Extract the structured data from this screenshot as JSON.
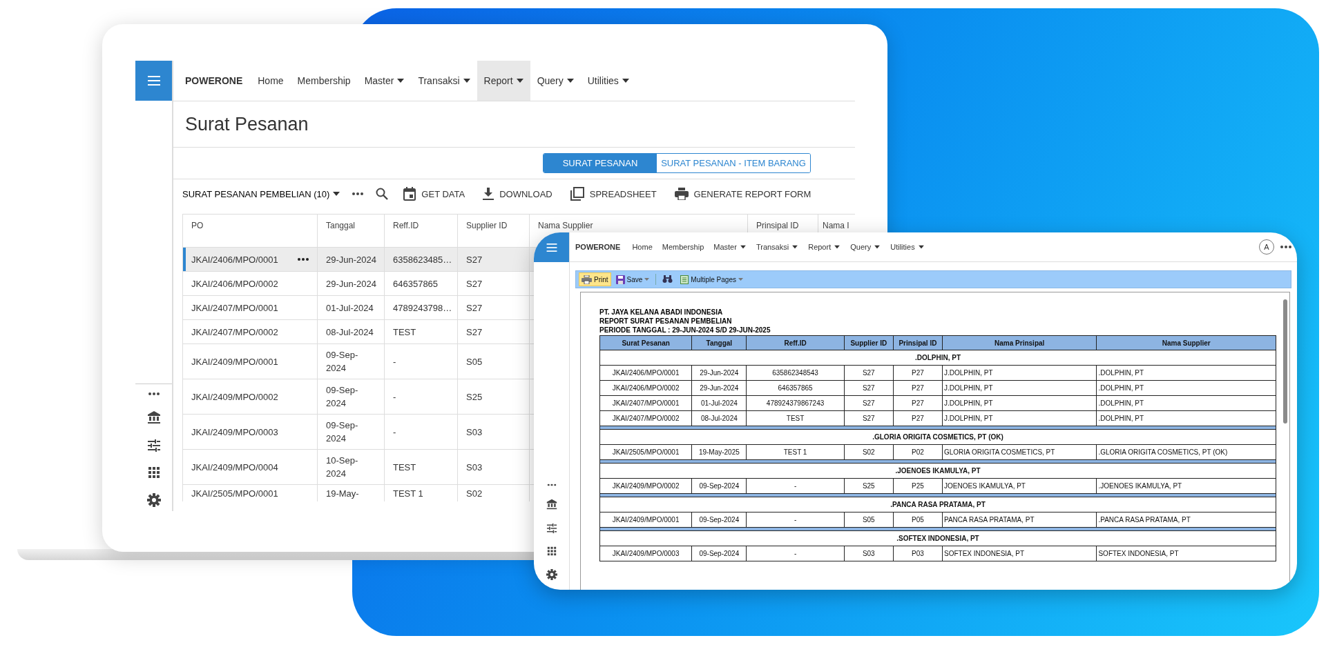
{
  "laptop": {
    "navbar": {
      "brand": "POWERONE",
      "items": [
        {
          "label": "Home",
          "dropdown": false,
          "selected": false
        },
        {
          "label": "Membership",
          "dropdown": false,
          "selected": false
        },
        {
          "label": "Master",
          "dropdown": true,
          "selected": false
        },
        {
          "label": "Transaksi",
          "dropdown": true,
          "selected": false
        },
        {
          "label": "Report",
          "dropdown": true,
          "selected": true
        },
        {
          "label": "Query",
          "dropdown": true,
          "selected": false
        },
        {
          "label": "Utilities",
          "dropdown": true,
          "selected": false
        }
      ]
    },
    "page_title": "Surat Pesanan",
    "view_tabs": [
      {
        "label": "SURAT PESANAN",
        "selected": true
      },
      {
        "label": "SURAT PESANAN - ITEM BARANG",
        "selected": false
      }
    ],
    "toolbar": {
      "report_select": "SURAT PESANAN PEMBELIAN (10)",
      "actions": [
        {
          "kind": "more"
        },
        {
          "kind": "search"
        },
        {
          "kind": "get-data",
          "label": "GET DATA"
        },
        {
          "kind": "download",
          "label": "DOWNLOAD"
        },
        {
          "kind": "spreadsheet",
          "label": "SPREADSHEET"
        },
        {
          "kind": "print",
          "label": "GENERATE REPORT FORM"
        }
      ]
    },
    "table": {
      "columns": [
        "PO",
        "Tanggal",
        "Reff.ID",
        "Supplier ID",
        "Nama Supplier",
        "Prinsipal ID",
        "Nama I"
      ],
      "rows": [
        {
          "selected": true,
          "cells": [
            "JKAI/2406/MPO/0001",
            "29-Jun-2024",
            "6358623485…",
            "S27"
          ]
        },
        {
          "selected": false,
          "cells": [
            "JKAI/2406/MPO/0002",
            "29-Jun-2024",
            "646357865",
            "S27"
          ]
        },
        {
          "selected": false,
          "cells": [
            "JKAI/2407/MPO/0001",
            "01-Jul-2024",
            "4789243798…",
            "S27"
          ]
        },
        {
          "selected": false,
          "cells": [
            "JKAI/2407/MPO/0002",
            "08-Jul-2024",
            "TEST",
            "S27"
          ]
        },
        {
          "selected": false,
          "cells": [
            "JKAI/2409/MPO/0001",
            "09-Sep-2024",
            "-",
            "S05"
          ]
        },
        {
          "selected": false,
          "cells": [
            "JKAI/2409/MPO/0002",
            "09-Sep-2024",
            "-",
            "S25"
          ]
        },
        {
          "selected": false,
          "cells": [
            "JKAI/2409/MPO/0003",
            "09-Sep-2024",
            "-",
            "S03"
          ]
        },
        {
          "selected": false,
          "cells": [
            "JKAI/2409/MPO/0004",
            "10-Sep-2024",
            "TEST",
            "S03"
          ]
        },
        {
          "selected": false,
          "cells": [
            "JKAI/2505/MPO/0001",
            "19-May-",
            "TEST 1",
            "S02"
          ]
        }
      ]
    }
  },
  "tablet": {
    "navbar": {
      "brand": "POWERONE",
      "avatar": "A",
      "items": [
        {
          "label": "Home",
          "dropdown": false,
          "selected": false
        },
        {
          "label": "Membership",
          "dropdown": false,
          "selected": false
        },
        {
          "label": "Master",
          "dropdown": true,
          "selected": false
        },
        {
          "label": "Transaksi",
          "dropdown": true,
          "selected": false
        },
        {
          "label": "Report",
          "dropdown": true,
          "selected": false
        },
        {
          "label": "Query",
          "dropdown": true,
          "selected": false
        },
        {
          "label": "Utilities",
          "dropdown": true,
          "selected": false
        }
      ]
    },
    "report_toolbar": [
      {
        "kind": "print",
        "label": "Print",
        "selected": true,
        "dropdown": false
      },
      {
        "kind": "save",
        "label": "Save",
        "selected": false,
        "dropdown": true
      },
      {
        "kind": "find",
        "selected": false,
        "dropdown": false
      },
      {
        "kind": "pages",
        "label": "Multiple Pages",
        "selected": false,
        "dropdown": true
      }
    ],
    "report": {
      "header_lines": [
        "PT. JAYA KELANA ABADI INDONESIA",
        "REPORT SURAT PESANAN PEMBELIAN",
        "PERIODE TANGGAL : 29-JUN-2024 S/D 29-JUN-2025"
      ],
      "columns": [
        "Surat Pesanan",
        "Tanggal",
        "Reff.ID",
        "Supplier ID",
        "Prinsipal ID",
        "Nama Prinsipal",
        "Nama Supplier"
      ],
      "groups": [
        {
          "name": ".DOLPHIN, PT",
          "rows": [
            [
              "JKAI/2406/MPO/0001",
              "29-Jun-2024",
              "635862348543",
              "S27",
              "P27",
              "J.DOLPHIN, PT",
              ".DOLPHIN, PT"
            ],
            [
              "JKAI/2406/MPO/0002",
              "29-Jun-2024",
              "646357865",
              "S27",
              "P27",
              "J.DOLPHIN, PT",
              ".DOLPHIN, PT"
            ],
            [
              "JKAI/2407/MPO/0001",
              "01-Jul-2024",
              "478924379867243",
              "S27",
              "P27",
              "J.DOLPHIN, PT",
              ".DOLPHIN, PT"
            ],
            [
              "JKAI/2407/MPO/0002",
              "08-Jul-2024",
              "TEST",
              "S27",
              "P27",
              "J.DOLPHIN, PT",
              ".DOLPHIN, PT"
            ]
          ]
        },
        {
          "name": ".GLORIA ORIGITA COSMETICS, PT (OK)",
          "rows": [
            [
              "JKAI/2505/MPO/0001",
              "19-May-2025",
              "TEST 1",
              "S02",
              "P02",
              "GLORIA ORIGITA COSMETICS, PT",
              ".GLORIA ORIGITA COSMETICS, PT (OK)"
            ]
          ]
        },
        {
          "name": ".JOENOES IKAMULYA, PT",
          "rows": [
            [
              "JKAI/2409/MPO/0002",
              "09-Sep-2024",
              "-",
              "S25",
              "P25",
              "JOENOES IKAMULYA, PT",
              ".JOENOES IKAMULYA, PT"
            ]
          ]
        },
        {
          "name": ".PANCA RASA PRATAMA, PT",
          "rows": [
            [
              "JKAI/2409/MPO/0001",
              "09-Sep-2024",
              "-",
              "S05",
              "P05",
              "PANCA RASA PRATAMA, PT",
              ".PANCA RASA PRATAMA, PT"
            ]
          ]
        },
        {
          "name": ".SOFTEX INDONESIA, PT",
          "rows": [
            [
              "JKAI/2409/MPO/0003",
              "09-Sep-2024",
              "-",
              "S03",
              "P03",
              "SOFTEX INDONESIA, PT",
              "SOFTEX INDONESIA, PT"
            ]
          ]
        }
      ]
    }
  }
}
